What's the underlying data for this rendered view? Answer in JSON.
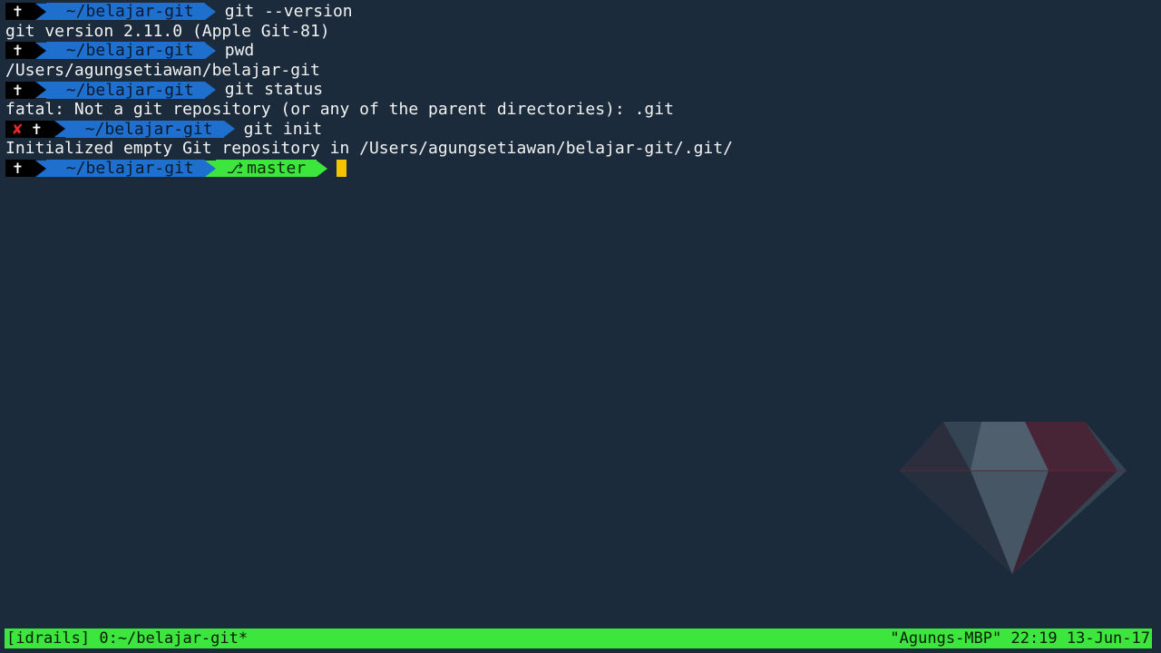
{
  "terminal": {
    "prompt_dir": "~/belajar-git",
    "status_symbol": "✝",
    "error_symbol": "✘",
    "lines": [
      {
        "kind": "prompt",
        "error": false,
        "command": "git --version"
      },
      {
        "kind": "output",
        "text": "git version 2.11.0 (Apple Git-81)"
      },
      {
        "kind": "prompt",
        "error": false,
        "command": "pwd"
      },
      {
        "kind": "output",
        "text": "/Users/agungsetiawan/belajar-git"
      },
      {
        "kind": "prompt",
        "error": false,
        "command": "git status"
      },
      {
        "kind": "output",
        "text": "fatal: Not a git repository (or any of the parent directories): .git"
      },
      {
        "kind": "prompt",
        "error": true,
        "command": "git init"
      },
      {
        "kind": "output",
        "text": "Initialized empty Git repository in /Users/agungsetiawan/belajar-git/.git/"
      },
      {
        "kind": "prompt",
        "error": false,
        "branch": "master",
        "command": ""
      }
    ]
  },
  "status_bar": {
    "left": "[idrails] 0:~/belajar-git*",
    "right": "\"Agungs-MBP\" 22:19 13-Jun-17"
  },
  "colors": {
    "background": "#1b2b3b",
    "dir_segment": "#1e6fce",
    "branch_segment": "#3ce63c",
    "status_bar": "#3ce63c",
    "error": "#e0282e",
    "cursor": "#f2c500"
  },
  "icons": {
    "branch": "git-branch-icon",
    "watermark": "ruby-gem-logo"
  }
}
